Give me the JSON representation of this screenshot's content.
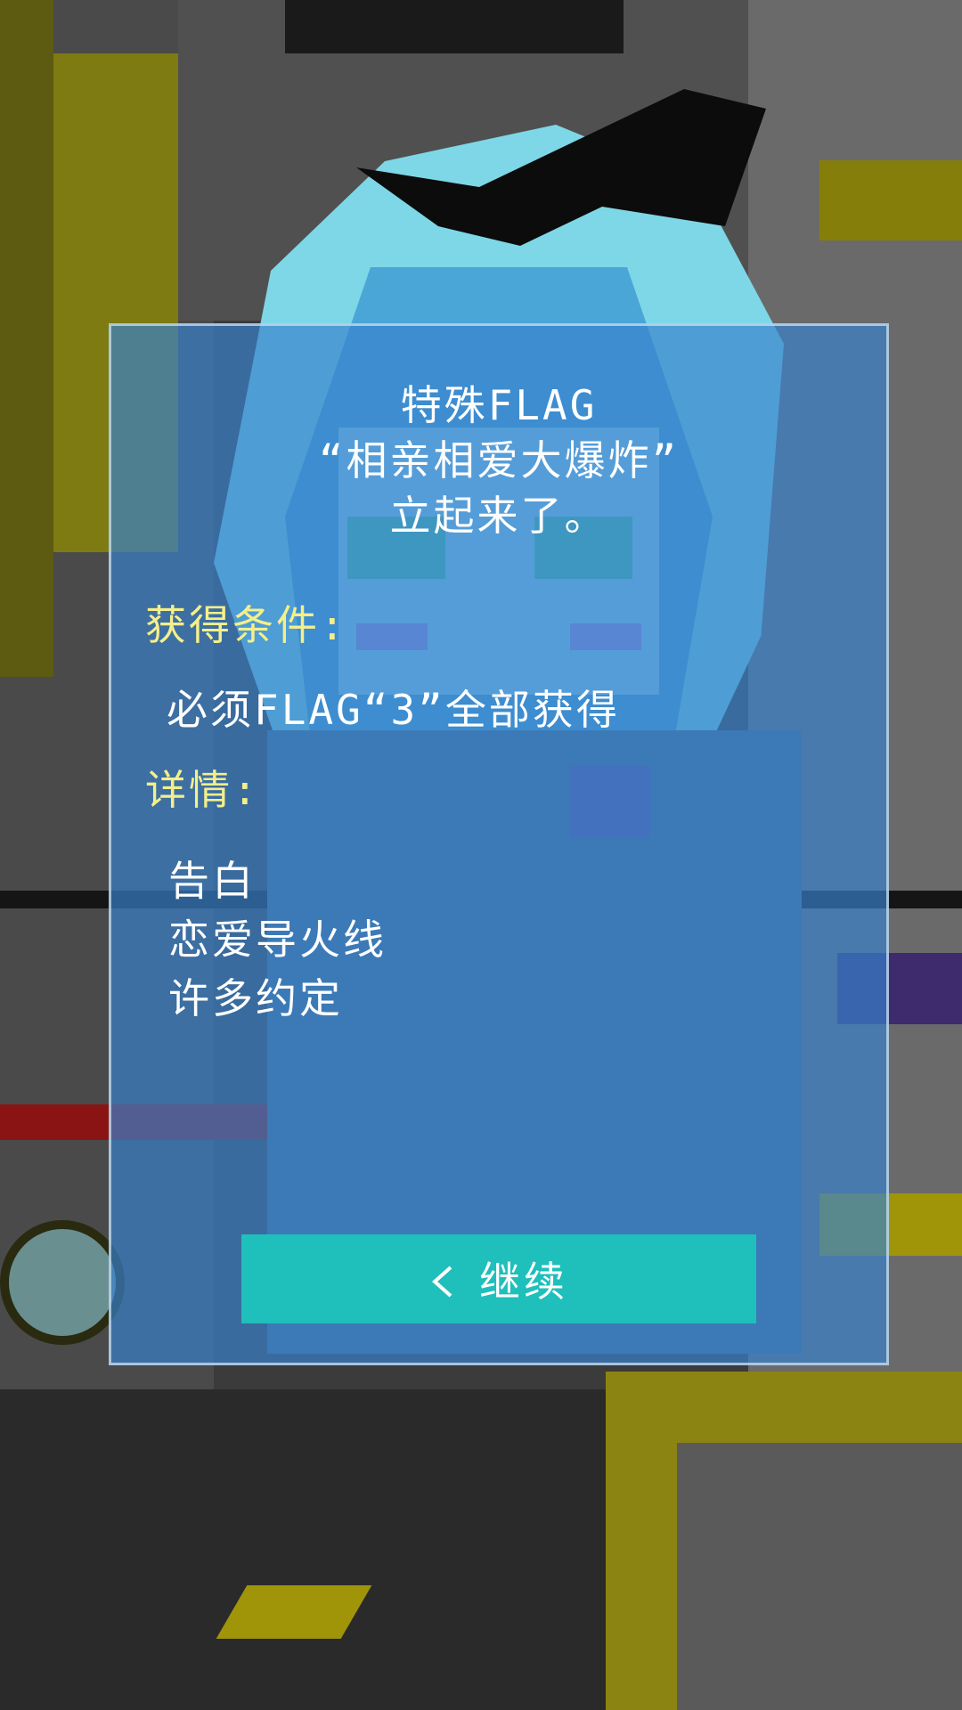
{
  "dialog": {
    "title_lines": [
      "特殊FLAG",
      "“相亲相爱大爆炸”",
      "立起来了。"
    ],
    "condition_label": "获得条件:",
    "condition_text": "必须FLAG“3”全部获得",
    "details_label": "详情:",
    "details": [
      "告白",
      "恋爱导火线",
      "许多约定"
    ],
    "continue_label": "继续",
    "continue_icon": "chevron-left-icon"
  },
  "colors": {
    "panel": "#3882cd",
    "label_yellow": "#f4ef8a",
    "button": "#1fbfbb"
  }
}
